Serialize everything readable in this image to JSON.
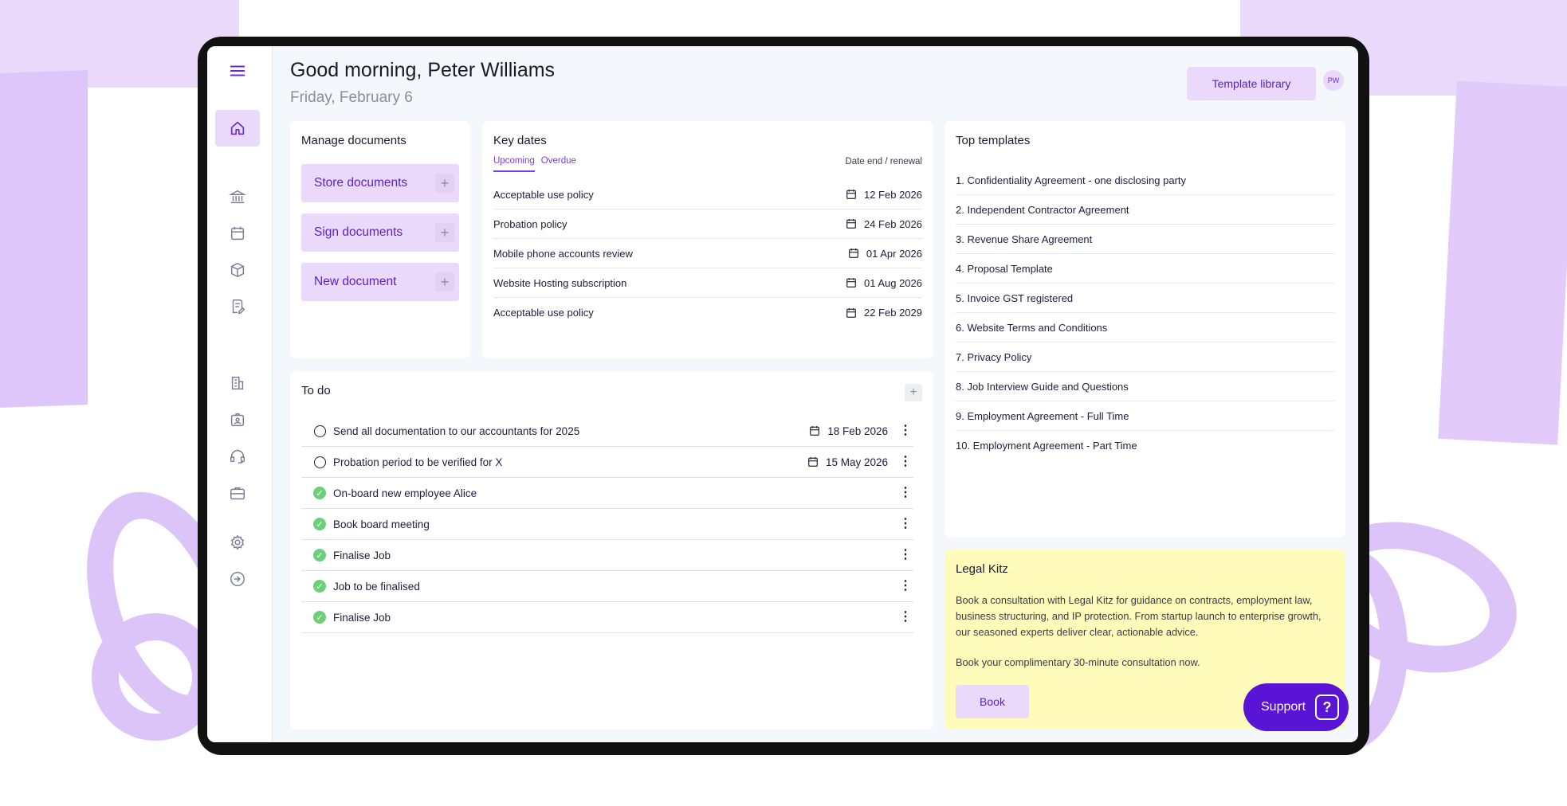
{
  "header": {
    "greeting": "Good morning, Peter Williams",
    "date": "Friday, February 6",
    "template_library": "Template library",
    "avatar_initials": "PW"
  },
  "sidebar": {
    "icons": [
      "menu-icon",
      "home-icon",
      "bank-icon",
      "calendar-icon",
      "box-icon",
      "document-sign-icon",
      "building-icon",
      "id-badge-icon",
      "support-headset-icon",
      "briefcase-icon",
      "settings-icon",
      "logout-icon"
    ]
  },
  "manage_documents": {
    "title": "Manage documents",
    "buttons": [
      {
        "label": "Store documents"
      },
      {
        "label": "Sign documents"
      },
      {
        "label": "New document"
      }
    ]
  },
  "key_dates": {
    "title": "Key dates",
    "tabs": [
      "Upcoming",
      "Overdue"
    ],
    "date_header": "Date end / renewal",
    "rows": [
      {
        "name": "Acceptable use policy",
        "date": "12 Feb 2026"
      },
      {
        "name": "Probation policy",
        "date": "24 Feb 2026"
      },
      {
        "name": "Mobile phone accounts review",
        "date": "01 Apr 2026"
      },
      {
        "name": "Website Hosting subscription",
        "date": "01 Aug 2026"
      },
      {
        "name": "Acceptable use policy",
        "date": "22 Feb 2029"
      }
    ]
  },
  "top_templates": {
    "title": "Top templates",
    "items": [
      "1. Confidentiality Agreement - one disclosing party",
      "2. Independent Contractor Agreement",
      "3. Revenue Share Agreement",
      "4. Proposal Template",
      "5. Invoice GST registered",
      "6. Website Terms and Conditions",
      "7. Privacy Policy",
      "8. Job Interview Guide and Questions",
      "9. Employment Agreement - Full Time",
      "10. Employment Agreement - Part Time"
    ]
  },
  "todo": {
    "title": "To do",
    "add": "+",
    "items": [
      {
        "text": "Send all documentation to our accountants for 2025",
        "date": "18 Feb 2026",
        "done": false
      },
      {
        "text": "Probation period to be verified for X",
        "date": "15 May 2026",
        "done": false
      },
      {
        "text": "On-board new employee Alice",
        "date": "",
        "done": true
      },
      {
        "text": "Book board meeting",
        "date": "",
        "done": true
      },
      {
        "text": "Finalise Job",
        "date": "",
        "done": true
      },
      {
        "text": "Job to be finalised",
        "date": "",
        "done": true
      },
      {
        "text": "Finalise Job",
        "date": "",
        "done": true
      }
    ]
  },
  "legal_kitz": {
    "title": "Legal Kitz",
    "body": "Book a consultation with Legal Kitz for guidance on contracts, employment law, business structuring, and IP protection. From startup launch to enterprise growth, our seasoned experts deliver clear, actionable advice.",
    "cta": "Book your complimentary 30-minute consultation now.",
    "button": "Book"
  },
  "support": {
    "label": "Support",
    "icon_glyph": "?"
  },
  "colors": {
    "accent": "#6a2bd8",
    "accent_light": "#ead9fb",
    "support_bg": "#5a14d6",
    "legal_bg": "#fffcbb",
    "done_green": "#6cd07a"
  }
}
